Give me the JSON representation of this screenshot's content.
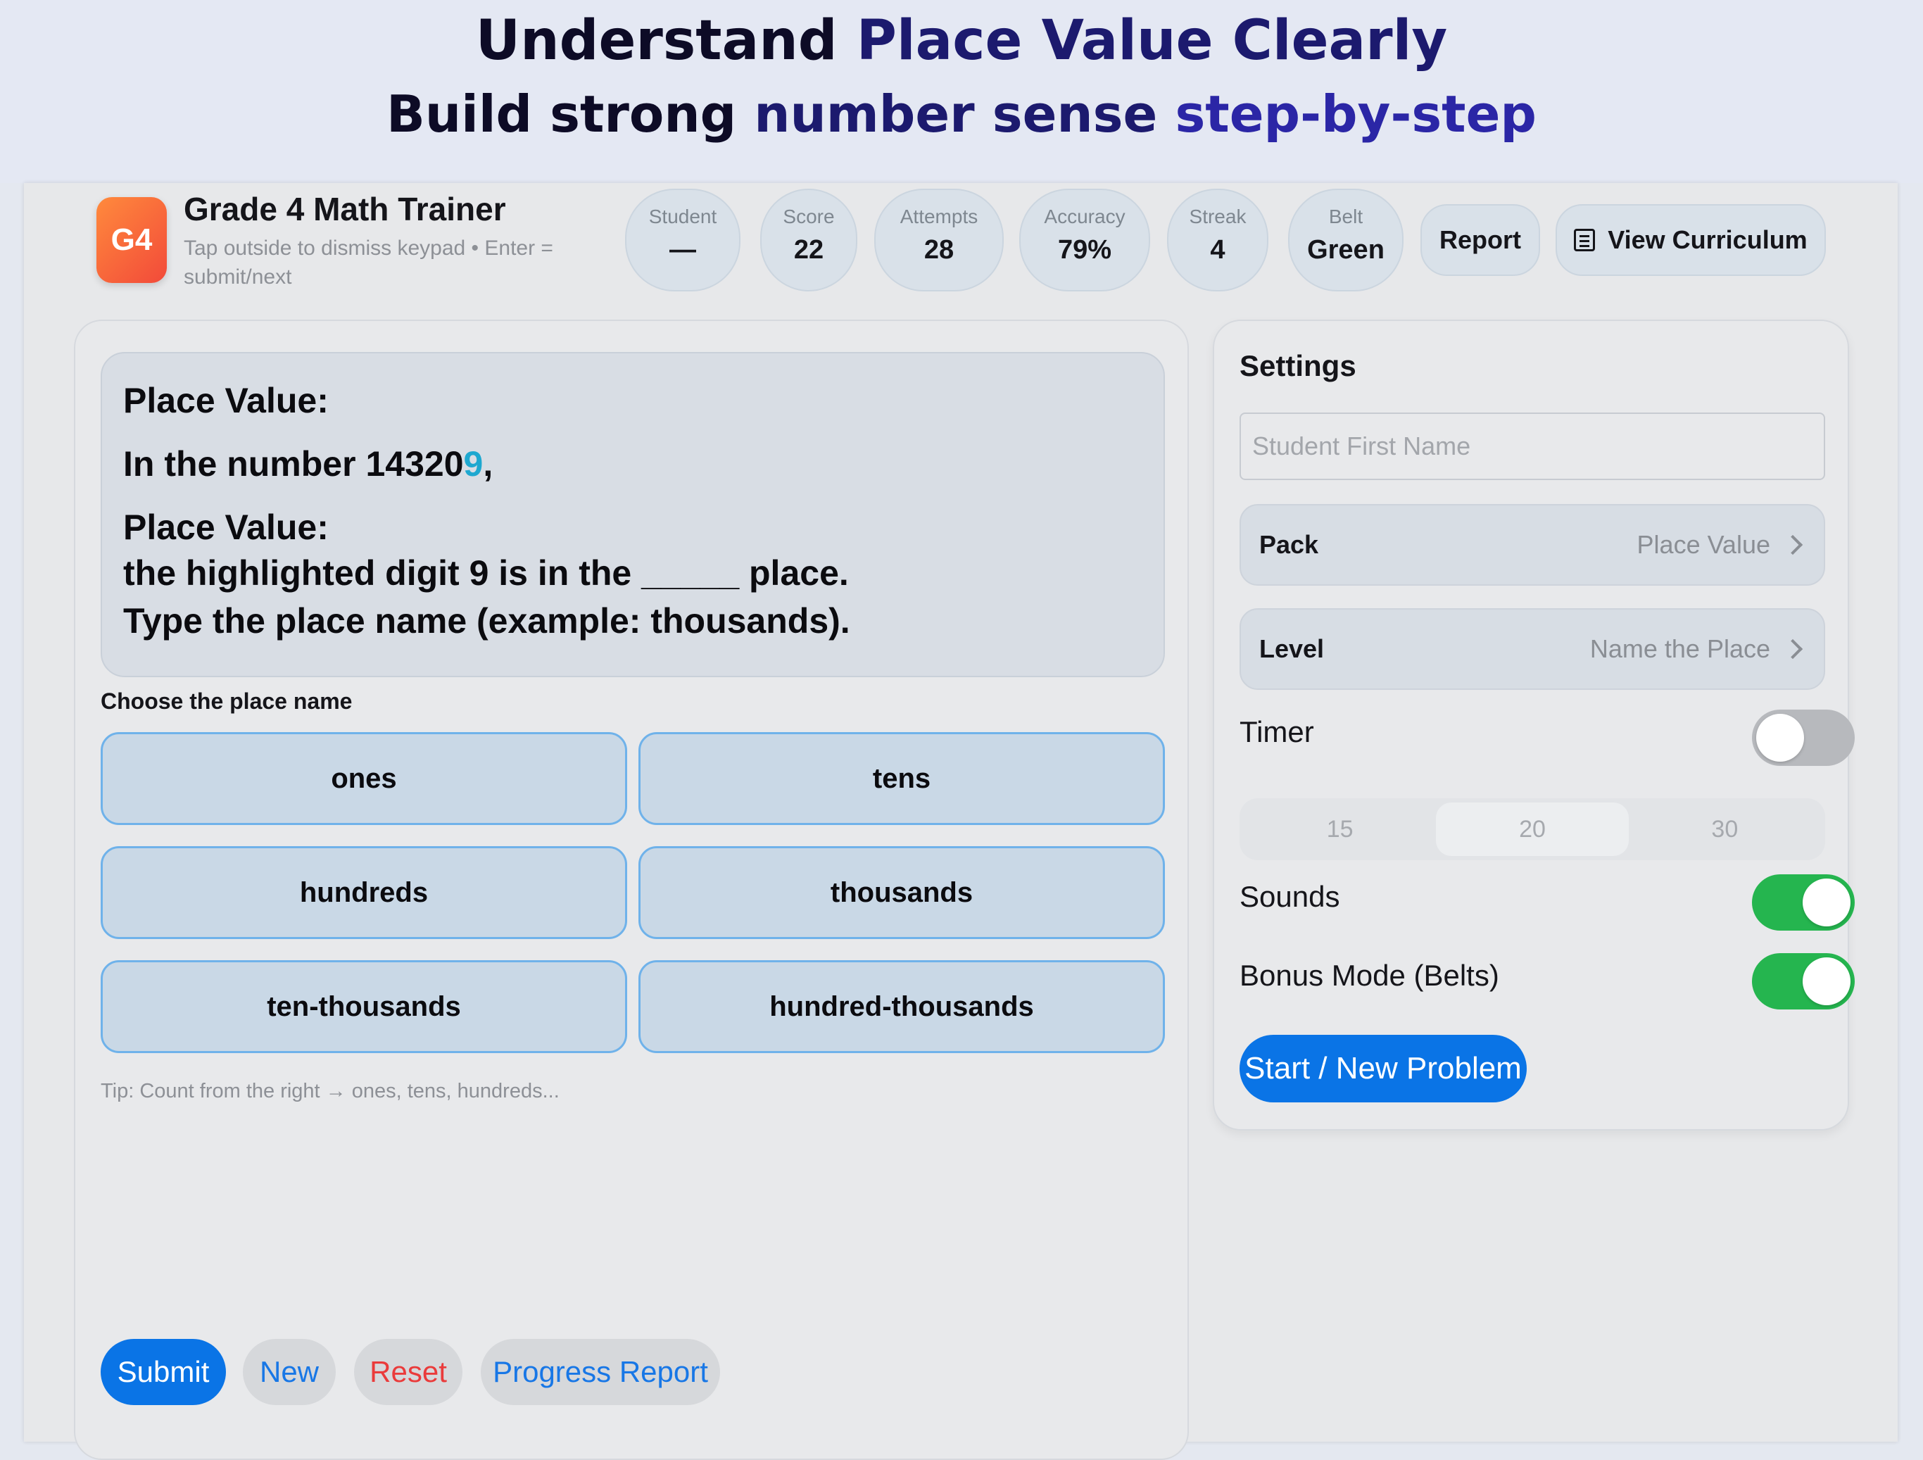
{
  "banner": {
    "title_part1": "Understand ",
    "title_part2": "Place Value Clearly",
    "subtitle_part1": "Build strong ",
    "subtitle_part2": "number sense ",
    "subtitle_part3": "step-by-step"
  },
  "header": {
    "logo_text": "G4",
    "app_title": "Grade 4 Math Trainer",
    "app_subtitle": "Tap outside to dismiss keypad • Enter = submit/next",
    "stats": [
      {
        "label": "Student",
        "value": "—"
      },
      {
        "label": "Score",
        "value": "22"
      },
      {
        "label": "Attempts",
        "value": "28"
      },
      {
        "label": "Accuracy",
        "value": "79%"
      },
      {
        "label": "Streak",
        "value": "4"
      },
      {
        "label": "Belt",
        "value": "Green"
      }
    ],
    "report_label": "Report",
    "curriculum_label": "View Curriculum",
    "curriculum_icon": "document-list-icon"
  },
  "question": {
    "line1": "Place Value:",
    "line2_prefix": "In the number 14320",
    "line2_highlight": "9",
    "line2_suffix": ",",
    "line3": "Place Value:",
    "line4": "the highlighted digit 9 is in the _____ place.",
    "line5": "Type the place name (example: thousands).",
    "highlight_color": "#1ea8d0"
  },
  "choices": {
    "label": "Choose the place name",
    "options": [
      "ones",
      "tens",
      "hundreds",
      "thousands",
      "ten-thousands",
      "hundred-thousands"
    ]
  },
  "tip": "Tip: Count from the right → ones, tens, hundreds...",
  "actions": {
    "submit": "Submit",
    "new": "New",
    "reset": "Reset",
    "progress_report": "Progress Report"
  },
  "settings": {
    "title": "Settings",
    "name_placeholder": "Student First Name",
    "name_value": "",
    "pack_label": "Pack",
    "pack_value": "Place Value",
    "level_label": "Level",
    "level_value": "Name the Place",
    "timer_label": "Timer",
    "timer_on": false,
    "timer_options": [
      "15",
      "20",
      "30"
    ],
    "timer_selected": "20",
    "sounds_label": "Sounds",
    "sounds_on": true,
    "bonus_label": "Bonus Mode (Belts)",
    "bonus_on": true,
    "start_label": "Start / New Problem"
  },
  "colors": {
    "accent": "#0a74e6",
    "toggle_on": "#25b54f",
    "reset_text": "#ea3b3b",
    "choice_border": "#6fb2ea"
  }
}
